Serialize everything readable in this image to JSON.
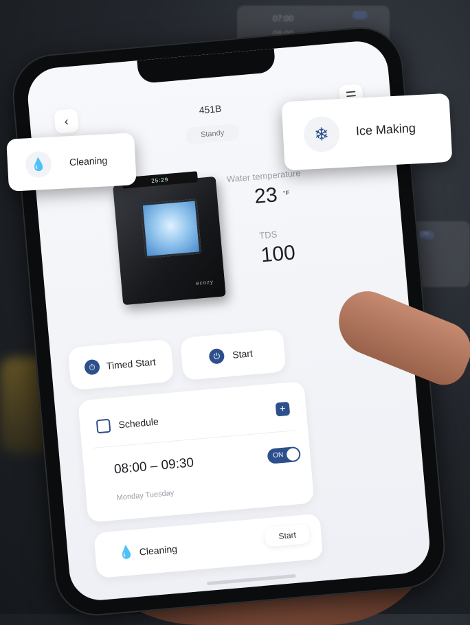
{
  "header": {
    "model": "451B",
    "status": "Standy",
    "back_icon": "chevron-left-icon",
    "menu_icon": "menu-icon"
  },
  "device": {
    "brand": "ecozy",
    "display_time": "25:29"
  },
  "readings": {
    "water_temperature_label": "Water temperature",
    "water_temperature_value": "23",
    "water_temperature_unit": "°F",
    "tds_label": "TDS",
    "tds_value": "100"
  },
  "actions": {
    "timed_start_label": "Timed Start",
    "start_label": "Start"
  },
  "schedule": {
    "title": "Schedule",
    "time_range": "08:00 – 09:30",
    "days": "Monday Tuesday",
    "toggle_label": "ON",
    "enabled": true
  },
  "cleaning_row": {
    "label": "Cleaning",
    "start_label": "Start"
  },
  "callouts": {
    "cleaning": "Cleaning",
    "ice_making": "Ice Making"
  },
  "background_cards": {
    "time_a": "07:00",
    "time_b": "08:00",
    "toggle_label": "ON"
  },
  "colors": {
    "accent": "#2d4f8c",
    "cleaning_green": "#2e9a5b"
  }
}
